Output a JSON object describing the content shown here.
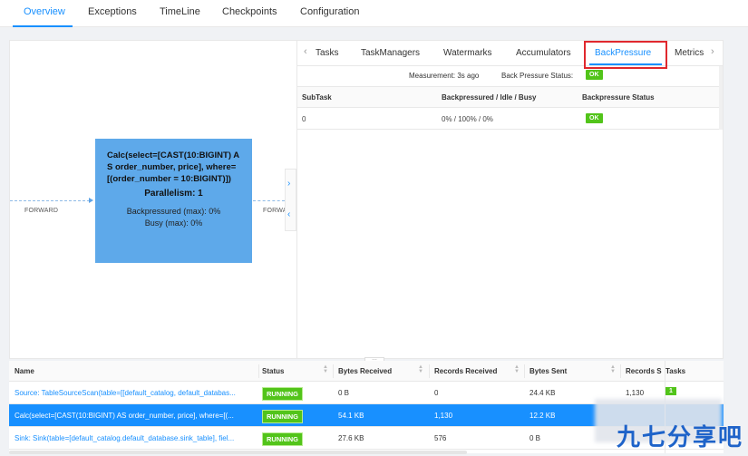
{
  "top_tabs": [
    "Overview",
    "Exceptions",
    "TimeLine",
    "Checkpoints",
    "Configuration"
  ],
  "active_top_tab": "Overview",
  "graph": {
    "edge_left_label": "FORWARD",
    "edge_right_label": "FORWA",
    "node": {
      "operator": "Calc(select=[CAST(10:BIGINT) AS order_number, price], where=[(order_number = 10:BIGINT)])",
      "parallelism": "Parallelism: 1",
      "backpressured": "Backpressured (max): 0%",
      "busy": "Busy (max): 0%"
    }
  },
  "panel": {
    "tabs": [
      "Tasks",
      "TaskManagers",
      "Watermarks",
      "Accumulators",
      "BackPressure",
      "Metrics"
    ],
    "active_tab": "BackPressure",
    "measurement": "Measurement: 3s ago",
    "status_label": "Back Pressure Status:",
    "status_value": "OK",
    "columns": [
      "SubTask",
      "Backpressured / Idle / Busy",
      "Backpressure Status"
    ],
    "rows": [
      {
        "subtask": "0",
        "ratio": "0% / 100% / 0%",
        "status": "OK"
      }
    ]
  },
  "vertex_table": {
    "columns": [
      "Name",
      "Status",
      "Bytes Received",
      "Records Received",
      "Bytes Sent",
      "Records S",
      "Tasks"
    ],
    "rows": [
      {
        "name": "Source: TableSourceScan(table=[[default_catalog, default_databas...",
        "status": "RUNNING",
        "bytes_received": "0 B",
        "records_received": "0",
        "bytes_sent": "24.4 KB",
        "records_sent": "1,130",
        "tasks": "1",
        "selected": false
      },
      {
        "name": "Calc(select=[CAST(10:BIGINT) AS order_number, price], where=[(...",
        "status": "RUNNING",
        "bytes_received": "54.1 KB",
        "records_received": "1,130",
        "bytes_sent": "12.2 KB",
        "records_sent": "",
        "tasks": "",
        "selected": true
      },
      {
        "name": "Sink: Sink(table=[default_catalog.default_database.sink_table], fiel...",
        "status": "RUNNING",
        "bytes_received": "27.6 KB",
        "records_received": "576",
        "bytes_sent": "0 B",
        "records_sent": "",
        "tasks": "",
        "selected": false
      }
    ]
  },
  "watermark": "九七分享吧",
  "colors": {
    "accent": "#1890ff",
    "node": "#5ea9ea",
    "ok": "#52c41a",
    "highlight_box": "#e0282e"
  }
}
